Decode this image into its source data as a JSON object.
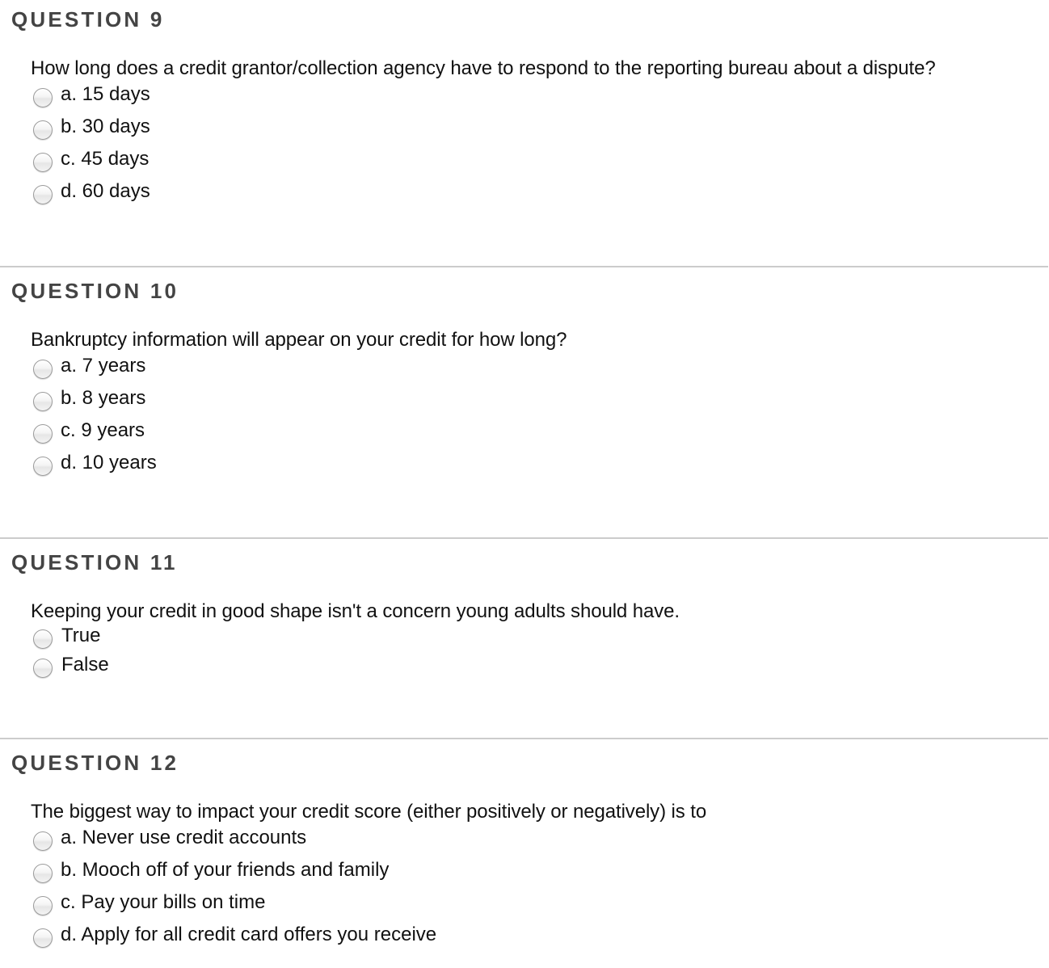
{
  "questions": [
    {
      "heading": "QUESTION 9",
      "text": "How long does a credit grantor/collection agency have to respond to the reporting bureau about a dispute?",
      "options": [
        {
          "label": "a. 15 days",
          "selected": false
        },
        {
          "label": "b. 30 days",
          "selected": false
        },
        {
          "label": "c. 45 days",
          "selected": false
        },
        {
          "label": "d. 60 days",
          "selected": false
        }
      ]
    },
    {
      "heading": "QUESTION 10",
      "text": "Bankruptcy information will appear on your credit for how long?",
      "options": [
        {
          "label": "a. 7 years",
          "selected": false
        },
        {
          "label": "b. 8 years",
          "selected": false
        },
        {
          "label": "c. 9 years",
          "selected": false
        },
        {
          "label": "d. 10 years",
          "selected": false
        }
      ]
    },
    {
      "heading": "QUESTION 11",
      "text": "Keeping your credit in good shape isn't a concern young adults should have.",
      "options": [
        {
          "label": "True",
          "selected": false
        },
        {
          "label": "False",
          "selected": false
        }
      ]
    },
    {
      "heading": "QUESTION 12",
      "text": "The biggest way to impact your credit score (either positively or negatively) is to",
      "options": [
        {
          "label": "a. Never use credit accounts",
          "selected": false
        },
        {
          "label": "b. Mooch off of your friends and family",
          "selected": false
        },
        {
          "label": "c. Pay your bills on time",
          "selected": false
        },
        {
          "label": "d. Apply for all credit card offers you receive",
          "selected": false
        }
      ]
    }
  ],
  "colors": {
    "heading": "#444444",
    "text": "#111111",
    "separator": "#cccccc"
  }
}
